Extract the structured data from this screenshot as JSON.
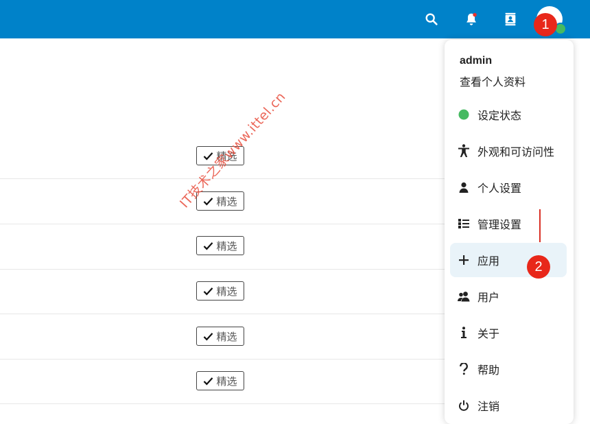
{
  "topbar": {
    "icons": [
      "search-icon",
      "bell-icon",
      "contacts-icon"
    ],
    "notification_dot_color": "#e9322d",
    "user_status_color": "#46ba61"
  },
  "annotations": {
    "step1": "1",
    "step2": "2"
  },
  "app_list": {
    "rows": [
      {
        "featured_label": "精选"
      },
      {
        "featured_label": "精选"
      },
      {
        "featured_label": "精选"
      },
      {
        "featured_label": "精选"
      },
      {
        "featured_label": "精选"
      },
      {
        "featured_label": "精选"
      }
    ]
  },
  "user_menu": {
    "username": "admin",
    "view_profile": "查看个人资料",
    "items": [
      {
        "label": "设定状态",
        "icon": "status-dot-icon"
      },
      {
        "label": "外观和可访问性",
        "icon": "accessibility-icon"
      },
      {
        "label": "个人设置",
        "icon": "user-icon"
      },
      {
        "label": "管理设置",
        "icon": "admin-settings-icon"
      },
      {
        "label": "应用",
        "icon": "plus-icon"
      },
      {
        "label": "用户",
        "icon": "users-icon"
      },
      {
        "label": "关于",
        "icon": "info-icon"
      },
      {
        "label": "帮助",
        "icon": "help-icon"
      },
      {
        "label": "注销",
        "icon": "logout-icon"
      }
    ]
  },
  "watermark": "IT技术之家www.ittel.cn",
  "colors": {
    "header_blue": "#0082c9",
    "active_item_bg": "#e9f3f9",
    "badge_red": "#e8271a"
  }
}
